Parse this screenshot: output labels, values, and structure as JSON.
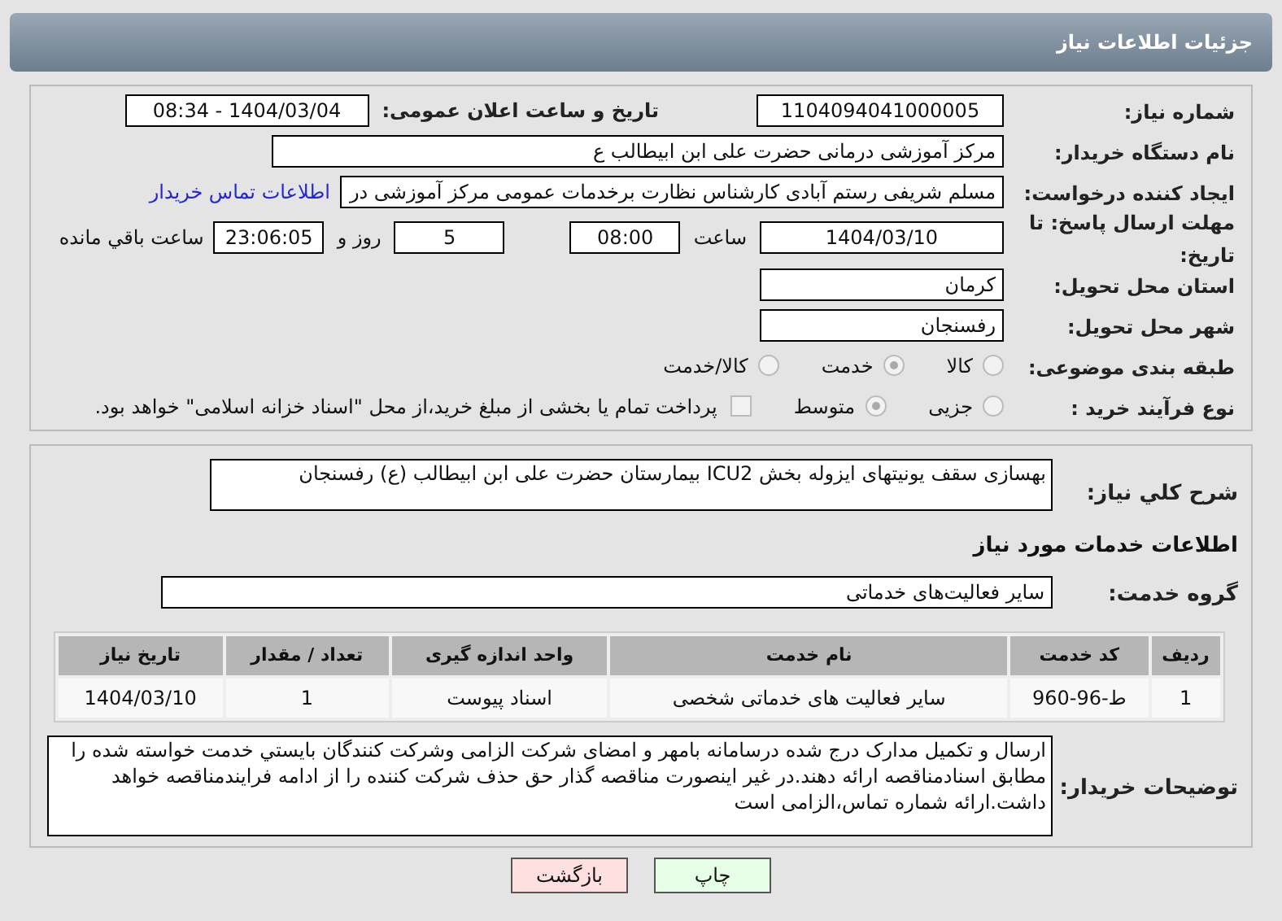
{
  "header": {
    "title": "جزئیات اطلاعات نیاز"
  },
  "need_number": {
    "label": "شماره نیاز:",
    "value": "1104094041000005"
  },
  "announce": {
    "label": "تاریخ و ساعت اعلان عمومی:",
    "value": "1404/03/04 - 08:34"
  },
  "buyer": {
    "label": "نام دستگاه خریدار:",
    "value": "مرکز آموزشی  درمانی حضرت علی ابن ابیطالب ع"
  },
  "creator": {
    "label": "ایجاد کننده درخواست:",
    "value": "مسلم شریفی رستم آبادی کارشناس نظارت برخدمات عمومی مرکز آموزشی  در",
    "link": "اطلاعات تماس خریدار"
  },
  "deadline": {
    "label": "مهلت ارسال پاسخ: تا تاریخ:",
    "date": "1404/03/10",
    "time_label": "ساعت",
    "time": "08:00",
    "days": "5",
    "days_label": "روز و",
    "remaining": "23:06:05",
    "remaining_label": "ساعت باقي مانده"
  },
  "province": {
    "label": "استان محل تحویل:",
    "value": "کرمان"
  },
  "city": {
    "label": "شهر محل تحویل:",
    "value": "رفسنجان"
  },
  "category": {
    "label": "طبقه بندی موضوعی:",
    "options": [
      {
        "label": "کالا",
        "selected": false
      },
      {
        "label": "خدمت",
        "selected": true
      },
      {
        "label": "کالا/خدمت",
        "selected": false
      }
    ]
  },
  "purchase_type": {
    "label": "نوع فرآیند خرید :",
    "options": [
      {
        "label": "جزیی",
        "selected": false
      },
      {
        "label": "متوسط",
        "selected": true
      }
    ],
    "payment": {
      "label": "پرداخت تمام یا بخشی از مبلغ خرید،از محل \"اسناد خزانه اسلامی\" خواهد بود.",
      "checked": false
    }
  },
  "description": {
    "label": "شرح کلي نیاز:",
    "value": "بهسازی سقف یونیتهای ایزوله بخش ICU2 بیمارستان حضرت علی ابن ابیطالب (ع) رفسنجان"
  },
  "services_heading": "اطلاعات خدمات مورد نیاز",
  "service_group": {
    "label": "گروه خدمت:",
    "value": "سایر فعالیت‌های خدماتی"
  },
  "table": {
    "columns": [
      "ردیف",
      "کد خدمت",
      "نام خدمت",
      "واحد اندازه گیری",
      "تعداد / مقدار",
      "تاریخ نیاز"
    ],
    "rows": [
      [
        "1",
        "ط-96-960",
        "سایر فعالیت های خدماتی شخصی",
        "اسناد پیوست",
        "1",
        "1404/03/10"
      ]
    ]
  },
  "buyer_notes": {
    "label": "توضیحات خریدار:",
    "value": "ارسال و تکمیل مدارک درج شده درسامانه بامهر و امضای شرکت الزامی وشرکت کنندگان بایستي خدمت خواسته شده را مطابق اسنادمناقصه ارائه دهند.در غیر اینصورت مناقصه گذار حق حذف شرکت کننده را از ادامه فرایندمناقصه خواهد داشت.ارائه شماره تماس،الزامی است"
  },
  "buttons": {
    "print": "چاپ",
    "back": "بازگشت"
  }
}
